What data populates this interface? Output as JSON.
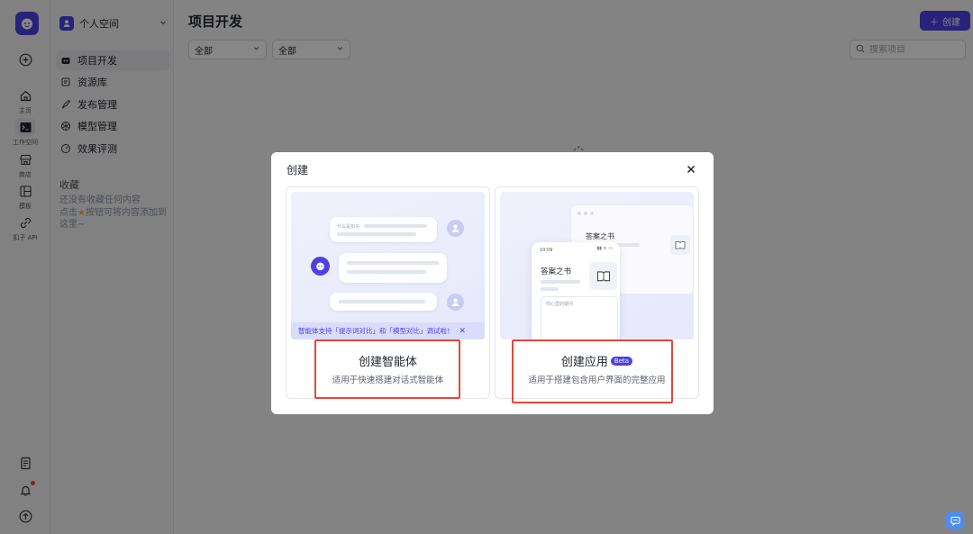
{
  "rail": {
    "items": [
      {
        "label": "主页"
      },
      {
        "label": "工作空间"
      },
      {
        "label": "商店"
      },
      {
        "label": "模板"
      },
      {
        "label": "扣子 API"
      }
    ],
    "icons": {
      "logo": "coze-logo-icon",
      "add": "plus-circle-icon",
      "docs": "document-icon",
      "notifications": "bell-icon",
      "upgrade": "arrow-up-circle-icon"
    }
  },
  "sidebar": {
    "space_name": "个人空间",
    "nav": [
      {
        "label": "项目开发",
        "icon": "bot-icon"
      },
      {
        "label": "资源库",
        "icon": "library-icon"
      },
      {
        "label": "发布管理",
        "icon": "rocket-icon"
      },
      {
        "label": "模型管理",
        "icon": "model-icon"
      },
      {
        "label": "效果评测",
        "icon": "gauge-icon"
      }
    ],
    "favorites_title": "收藏",
    "favorites_empty_1": "还没有收藏任何内容",
    "favorites_empty_2": "点击",
    "favorites_empty_3": "按钮可将内容添加到这里~"
  },
  "main": {
    "title": "项目开发",
    "create_label": "创建",
    "filter_1": "全部",
    "filter_2": "全部",
    "search_placeholder": "搜索项目"
  },
  "modal": {
    "title": "创建",
    "agent": {
      "title": "创建智能体",
      "desc": "适用于快速搭建对话式智能体",
      "banner": "智能体支持「提示词对比」和「模型对比」调试啦！",
      "bubble_text": "什么是扣子"
    },
    "app": {
      "title": "创建应用",
      "badge": "Beta",
      "desc": "适用于搭建包含用户界面的完整应用",
      "window_title": "答案之书",
      "phone_time": "10:09",
      "phone_title": "答案之书",
      "phone_input": "你心里的疑问"
    }
  },
  "colors": {
    "accent": "#4e40e5",
    "highlight": "#e2483a"
  }
}
